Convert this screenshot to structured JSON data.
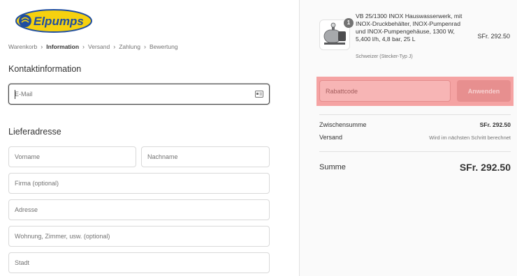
{
  "logo": {
    "text": "Elpumps"
  },
  "breadcrumb": {
    "items": [
      "Warenkorb",
      "Information",
      "Versand",
      "Zahlung",
      "Bewertung"
    ],
    "active_index": 1,
    "separator": "›"
  },
  "contact": {
    "title": "Kontaktinformation",
    "email_placeholder": "E-Mail"
  },
  "shipping": {
    "title": "Lieferadresse",
    "first_name_placeholder": "Vorname",
    "last_name_placeholder": "Nachname",
    "company_placeholder": "Firma (optional)",
    "address_placeholder": "Adresse",
    "apartment_placeholder": "Wohnung, Zimmer, usw. (optional)",
    "city_placeholder": "Stadt"
  },
  "order": {
    "product_name": "VB 25/1300 INOX Hauswasserwerk, mit INOX-Druckbehälter, INOX-Pumpenrad und INOX-Pumpengehäuse, 1300 W, 5,400 l/h, 4,8 bar, 25 L",
    "product_variant": "Schweizer (Stecker-Typ J)",
    "product_price": "SFr. 292.50",
    "quantity": "1",
    "discount_placeholder": "Rabattcode",
    "apply_label": "Anwenden",
    "subtotal_label": "Zwischensumme",
    "subtotal_value": "SFr. 292.50",
    "shipping_label": "Versand",
    "shipping_value": "Wird im nächsten Schritt berechnet",
    "total_label": "Summe",
    "total_value": "SFr. 292.50"
  },
  "colors": {
    "logo_blue": "#1f4ea1",
    "logo_yellow": "#f6d10f",
    "highlight": "#f5a3a3"
  }
}
